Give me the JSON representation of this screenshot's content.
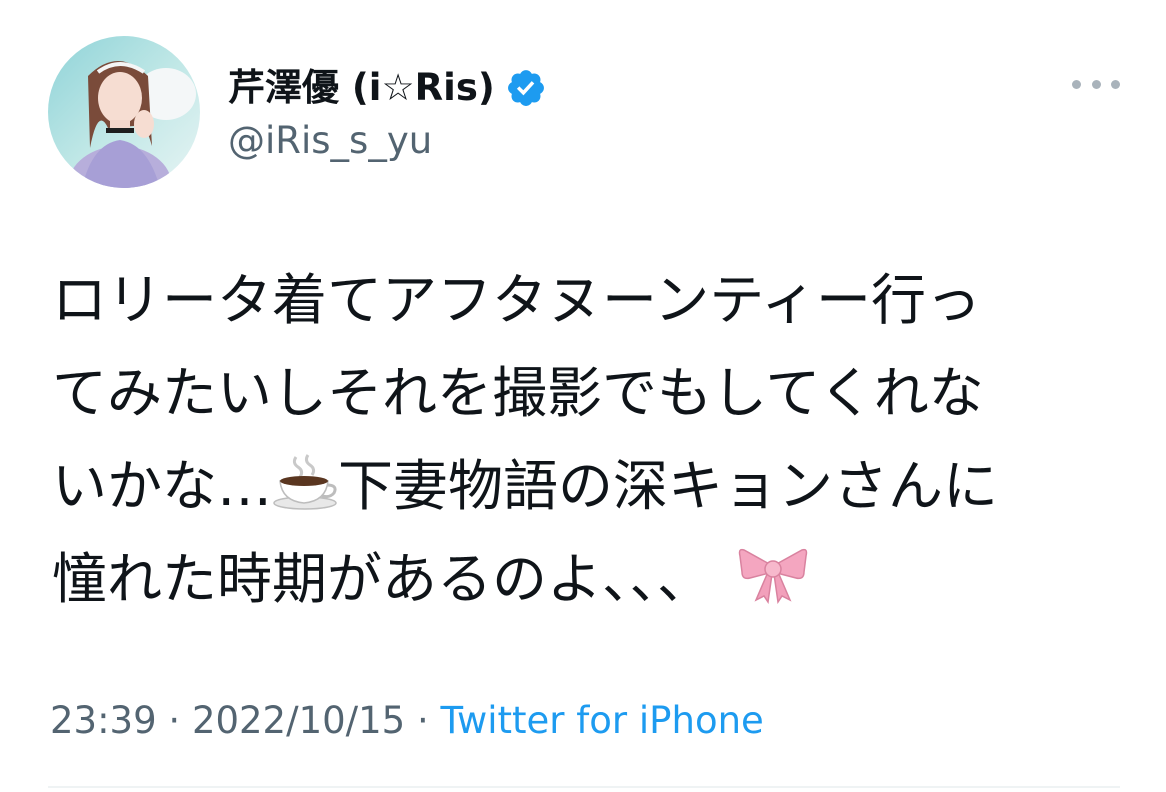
{
  "author": {
    "display_name": "芹澤優 (i☆Ris)",
    "handle": "@iRis_s_yu",
    "verified": true,
    "avatar_icon": "profile-photo"
  },
  "tweet": {
    "lines": [
      "ロリータ着てアフタヌーンティー行っ",
      "てみたいしそれを撮影でもしてくれな",
      "いかな…",
      "下妻物語の深キョンさんに",
      "憧れた時期があるのよ、、、"
    ],
    "emojis": [
      "coffee-cup-emoji",
      "ribbon-emoji"
    ]
  },
  "meta": {
    "time": "23:39",
    "separator": " · ",
    "date": "2022/10/15",
    "source": "Twitter for iPhone"
  },
  "colors": {
    "text": "#0f1419",
    "secondary": "#536471",
    "accent": "#1d9bf0",
    "verified_badge": "#1d9bf0",
    "ribbon": "#f4a6c0"
  },
  "icons": {
    "more": "more-horizontal-icon",
    "verified": "verified-badge-icon"
  }
}
